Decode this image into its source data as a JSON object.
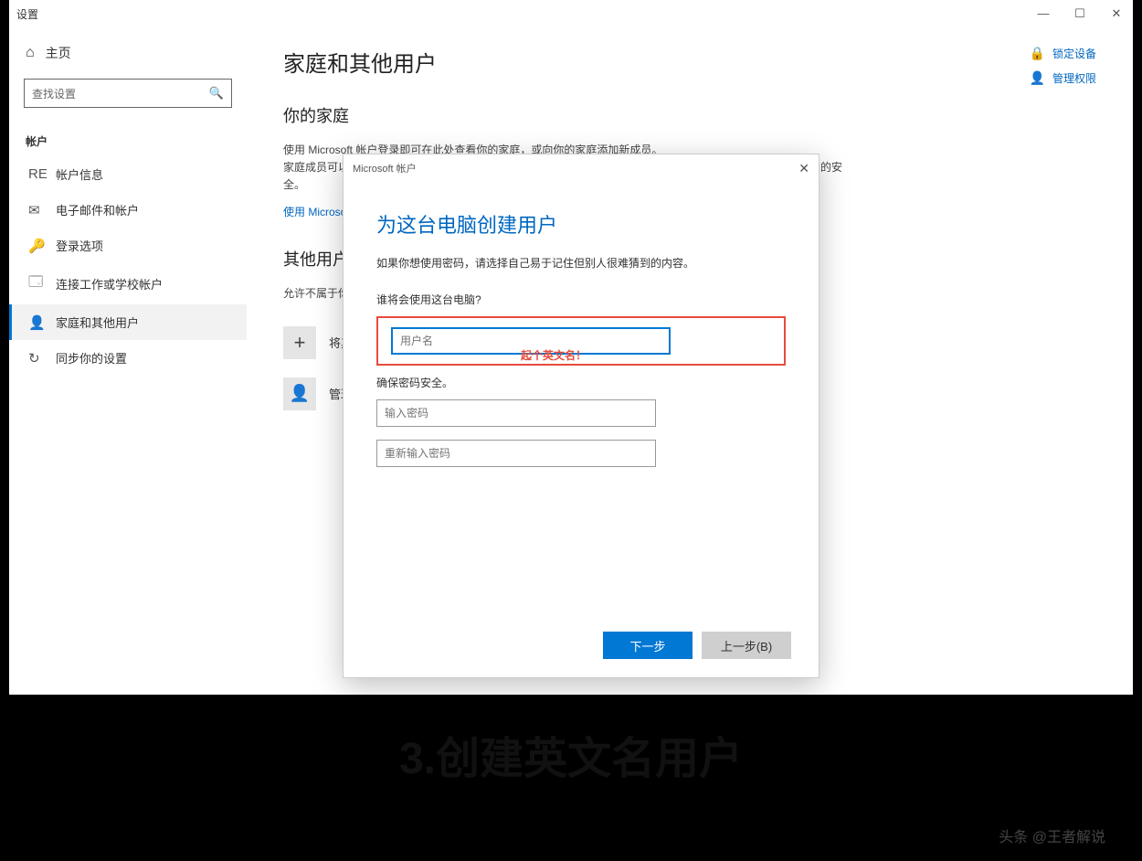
{
  "window": {
    "title": "设置",
    "controls": {
      "min": "—",
      "max": "☐",
      "close": "✕"
    }
  },
  "sidebar": {
    "home_label": "主页",
    "search_placeholder": "查找设置",
    "section_label": "帐户",
    "items": [
      {
        "icon": "RE",
        "label": "帐户信息"
      },
      {
        "icon": "✉",
        "label": "电子邮件和帐户"
      },
      {
        "icon": "🔑",
        "label": "登录选项"
      },
      {
        "icon": "🗔",
        "label": "连接工作或学校帐户"
      },
      {
        "icon": "👤",
        "label": "家庭和其他用户"
      },
      {
        "icon": "↻",
        "label": "同步你的设置"
      }
    ]
  },
  "content": {
    "page_title": "家庭和其他用户",
    "section1_title": "你的家庭",
    "desc_line1": "使用 Microsoft 帐户登录即可在此处查看你的家庭，或向你的家庭添加新成员。",
    "desc_line2": "家庭成员可以获得他们自己的登录名和桌面。你可以通过设置合适的网站、时间限制、应用和游戏来确保孩子们的安全。",
    "link_text": "使用 Microsoft 帐户登录",
    "section2_title": "其他用户",
    "section2_desc": "允许不属于你家庭的用户使用其自己的帐户来登录。这样不会将其添加到你的家庭中。",
    "add_label": "将其他人添加到这台电脑",
    "user_label": "管理员"
  },
  "right_links": [
    {
      "icon": "🔒",
      "label": "锁定设备"
    },
    {
      "icon": "👤",
      "label": "管理权限"
    }
  ],
  "modal": {
    "titlebar": "Microsoft 帐户",
    "heading": "为这台电脑创建用户",
    "desc": "如果你想使用密码，请选择自己易于记住但别人很难猜到的内容。",
    "q1": "谁将会使用这台电脑?",
    "username_placeholder": "用户名",
    "q2": "确保密码安全。",
    "pw_placeholder": "输入密码",
    "pw2_placeholder": "重新输入密码",
    "primary_btn": "下一步",
    "secondary_btn": "上一步(B)"
  },
  "annotations": {
    "red_note": "起个英文名！",
    "caption": "3.创建英文名用户",
    "watermark": "头条 @王者解说"
  }
}
